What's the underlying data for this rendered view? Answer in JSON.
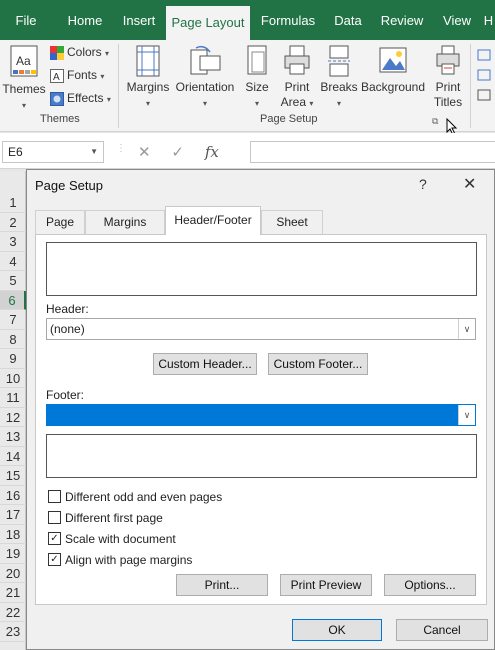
{
  "ribbon_tabs": [
    "File",
    "Home",
    "Insert",
    "Page Layout",
    "Formulas",
    "Data",
    "Review",
    "View",
    "H"
  ],
  "ribbon": {
    "themes_label": "Themes",
    "colors_label": "Colors",
    "fonts_label": "Fonts",
    "effects_label": "Effects",
    "themes_group": "Themes",
    "margins": "Margins",
    "orientation": "Orientation",
    "size": "Size",
    "print_area_1": "Print",
    "print_area_2": "Area",
    "breaks": "Breaks",
    "background": "Background",
    "print_titles_1": "Print",
    "print_titles_2": "Titles",
    "page_setup_group": "Page Setup"
  },
  "formula_bar": {
    "name_box": "E6",
    "fx": "fx",
    "value": ""
  },
  "rows": [
    "1",
    "2",
    "3",
    "4",
    "5",
    "6",
    "7",
    "8",
    "9",
    "10",
    "11",
    "12",
    "13",
    "14",
    "15",
    "16",
    "17",
    "18",
    "19",
    "20",
    "21",
    "22",
    "23"
  ],
  "selected_row": "6",
  "dialog": {
    "title": "Page Setup",
    "help": "?",
    "close": "✕",
    "tabs": [
      "Page",
      "Margins",
      "Header/Footer",
      "Sheet"
    ],
    "active_tab": "Header/Footer",
    "header_label": "Header:",
    "header_value": "(none)",
    "custom_header": "Custom Header...",
    "custom_footer": "Custom Footer...",
    "footer_label": "Footer:",
    "footer_value": "",
    "checkboxes": [
      {
        "label": "Different odd and even pages",
        "checked": false
      },
      {
        "label": "Different first page",
        "checked": false
      },
      {
        "label": "Scale with document",
        "checked": true
      },
      {
        "label": "Align with page margins",
        "checked": true
      }
    ],
    "print": "Print...",
    "print_preview": "Print Preview",
    "options": "Options...",
    "ok": "OK",
    "cancel": "Cancel"
  },
  "colors": {
    "excel_green": "#217346",
    "selection_blue": "#0078d7"
  }
}
